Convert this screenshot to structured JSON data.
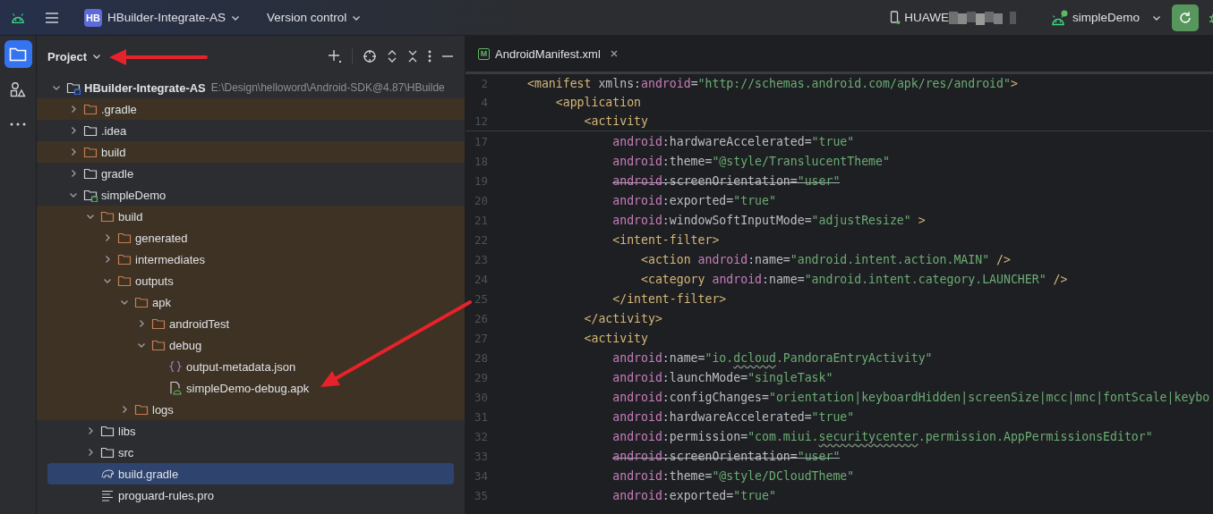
{
  "toolbar": {
    "project": {
      "badge": "HB",
      "name": "HBuilder-Integrate-AS"
    },
    "vcs": "Version control",
    "device": {
      "name": "HUAWE",
      "redacted": true
    },
    "run_config": "simpleDemo"
  },
  "tool_strip": [
    {
      "kind": "project",
      "selected": true
    },
    {
      "kind": "structure",
      "selected": false
    },
    {
      "kind": "more",
      "selected": false
    }
  ],
  "project_panel": {
    "title": "Project",
    "tree": [
      {
        "label": "HBuilder-Integrate-AS",
        "path": "E:\\Design\\helloword\\Android-SDK@4.87\\HBuilde",
        "kind": "module",
        "color": "#3574f0",
        "expanded": true,
        "selected": false,
        "excluded": false,
        "children": [
          {
            "label": ".gradle",
            "kind": "folder",
            "expanded": false,
            "selected": false,
            "excluded": true
          },
          {
            "label": ".idea",
            "kind": "folder",
            "expanded": false,
            "selected": false,
            "excluded": false
          },
          {
            "label": "build",
            "kind": "folder",
            "expanded": false,
            "selected": false,
            "excluded": true
          },
          {
            "label": "gradle",
            "kind": "folder",
            "expanded": false,
            "selected": false,
            "excluded": false
          },
          {
            "label": "simpleDemo",
            "kind": "module",
            "color": "#5fb865",
            "expanded": true,
            "selected": false,
            "excluded": false,
            "children": [
              {
                "label": "build",
                "kind": "folder",
                "expanded": true,
                "selected": false,
                "excluded": true,
                "children": [
                  {
                    "label": "generated",
                    "kind": "folder",
                    "expanded": false,
                    "selected": false,
                    "excluded": true
                  },
                  {
                    "label": "intermediates",
                    "kind": "folder",
                    "expanded": false,
                    "selected": false,
                    "excluded": true
                  },
                  {
                    "label": "outputs",
                    "kind": "folder",
                    "expanded": true,
                    "selected": false,
                    "excluded": true,
                    "children": [
                      {
                        "label": "apk",
                        "kind": "folder",
                        "expanded": true,
                        "selected": false,
                        "excluded": true,
                        "children": [
                          {
                            "label": "androidTest",
                            "kind": "folder",
                            "expanded": false,
                            "selected": false,
                            "excluded": true
                          },
                          {
                            "label": "debug",
                            "kind": "folder",
                            "expanded": true,
                            "selected": false,
                            "excluded": true,
                            "children": [
                              {
                                "label": "output-metadata.json",
                                "kind": "json",
                                "selected": false,
                                "excluded": true
                              },
                              {
                                "label": "simpleDemo-debug.apk",
                                "kind": "apk",
                                "selected": false,
                                "excluded": true
                              }
                            ]
                          }
                        ]
                      },
                      {
                        "label": "logs",
                        "kind": "folder",
                        "expanded": false,
                        "selected": false,
                        "excluded": true
                      }
                    ]
                  }
                ]
              },
              {
                "label": "libs",
                "kind": "folder",
                "expanded": false,
                "selected": false,
                "excluded": false
              },
              {
                "label": "src",
                "kind": "folder",
                "expanded": false,
                "selected": false,
                "excluded": false
              },
              {
                "label": "build.gradle",
                "kind": "gradle",
                "selected": true,
                "excluded": false
              },
              {
                "label": "proguard-rules.pro",
                "kind": "text",
                "selected": false,
                "excluded": false
              }
            ]
          }
        ]
      }
    ]
  },
  "editor": {
    "tabs": [
      {
        "icon_letter": "M",
        "label": "AndroidManifest.xml",
        "selected": true
      }
    ],
    "sticky_lines": [
      {
        "number": "2",
        "deprecated": false,
        "tokens": [
          {
            "kind": "tag",
            "text": "<manifest"
          },
          {
            "kind": "attr",
            "text": " xmlns:"
          },
          {
            "kind": "ns",
            "text": "android"
          },
          {
            "kind": "attr",
            "text": "="
          },
          {
            "kind": "string",
            "text": "\"http://schemas.android.com/apk/res/android\""
          },
          {
            "kind": "tag",
            "text": ">"
          }
        ]
      },
      {
        "number": "4",
        "deprecated": false,
        "tokens": [
          {
            "kind": "tag",
            "text": "    <application"
          }
        ]
      },
      {
        "number": "12",
        "deprecated": false,
        "tokens": [
          {
            "kind": "tag",
            "text": "        <activity"
          }
        ]
      }
    ],
    "lines": [
      {
        "number": "17",
        "deprecated": false,
        "tokens": [
          {
            "kind": "ns",
            "text": "            android"
          },
          {
            "kind": "attr",
            "text": ":hardwareAccelerated="
          },
          {
            "kind": "string",
            "text": "\"true\""
          }
        ]
      },
      {
        "number": "18",
        "deprecated": false,
        "tokens": [
          {
            "kind": "ns",
            "text": "            android"
          },
          {
            "kind": "attr",
            "text": ":theme="
          },
          {
            "kind": "string",
            "text": "\"@style/TranslucentTheme\""
          }
        ]
      },
      {
        "number": "19",
        "deprecated": true,
        "tokens": [
          {
            "kind": "ns",
            "text": "            android"
          },
          {
            "kind": "attr",
            "text": ":screenOrientation="
          },
          {
            "kind": "string",
            "text": "\"user\""
          }
        ]
      },
      {
        "number": "20",
        "deprecated": false,
        "tokens": [
          {
            "kind": "ns",
            "text": "            android"
          },
          {
            "kind": "attr",
            "text": ":exported="
          },
          {
            "kind": "string",
            "text": "\"true\""
          }
        ]
      },
      {
        "number": "21",
        "deprecated": false,
        "tokens": [
          {
            "kind": "ns",
            "text": "            android"
          },
          {
            "kind": "attr",
            "text": ":windowSoftInputMode="
          },
          {
            "kind": "string",
            "text": "\"adjustResize\""
          },
          {
            "kind": "tag",
            "text": " >"
          }
        ]
      },
      {
        "number": "22",
        "deprecated": false,
        "tokens": [
          {
            "kind": "tag",
            "text": "            <intent-filter>"
          }
        ]
      },
      {
        "number": "23",
        "deprecated": false,
        "tokens": [
          {
            "kind": "tag",
            "text": "                <action "
          },
          {
            "kind": "ns",
            "text": "android"
          },
          {
            "kind": "attr",
            "text": ":name="
          },
          {
            "kind": "string",
            "text": "\"android.intent.action.MAIN\""
          },
          {
            "kind": "tag",
            "text": " />"
          }
        ]
      },
      {
        "number": "24",
        "deprecated": false,
        "tokens": [
          {
            "kind": "tag",
            "text": "                <category "
          },
          {
            "kind": "ns",
            "text": "android"
          },
          {
            "kind": "attr",
            "text": ":name="
          },
          {
            "kind": "string",
            "text": "\"android.intent.category.LAUNCHER\""
          },
          {
            "kind": "tag",
            "text": " />"
          }
        ]
      },
      {
        "number": "25",
        "deprecated": false,
        "tokens": [
          {
            "kind": "tag",
            "text": "            </intent-filter>"
          }
        ]
      },
      {
        "number": "26",
        "deprecated": false,
        "tokens": [
          {
            "kind": "tag",
            "text": "        </activity>"
          }
        ]
      },
      {
        "number": "27",
        "deprecated": false,
        "tokens": [
          {
            "kind": "tag",
            "text": "        <activity"
          }
        ]
      },
      {
        "number": "28",
        "deprecated": false,
        "tokens": [
          {
            "kind": "ns",
            "text": "            android"
          },
          {
            "kind": "attr",
            "text": ":name="
          },
          {
            "kind": "string",
            "text": "\"io."
          },
          {
            "kind": "typo",
            "text": "dcloud"
          },
          {
            "kind": "string",
            "text": ".PandoraEntryActivity\""
          }
        ]
      },
      {
        "number": "29",
        "deprecated": false,
        "tokens": [
          {
            "kind": "ns",
            "text": "            android"
          },
          {
            "kind": "attr",
            "text": ":launchMode="
          },
          {
            "kind": "string",
            "text": "\"singleTask\""
          }
        ]
      },
      {
        "number": "30",
        "deprecated": false,
        "tokens": [
          {
            "kind": "ns",
            "text": "            android"
          },
          {
            "kind": "attr",
            "text": ":configChanges="
          },
          {
            "kind": "string",
            "text": "\"orientation|keyboardHidden|screenSize|mcc|mnc|fontScale|keybo"
          }
        ]
      },
      {
        "number": "31",
        "deprecated": false,
        "tokens": [
          {
            "kind": "ns",
            "text": "            android"
          },
          {
            "kind": "attr",
            "text": ":hardwareAccelerated="
          },
          {
            "kind": "string",
            "text": "\"true\""
          }
        ]
      },
      {
        "number": "32",
        "deprecated": false,
        "tokens": [
          {
            "kind": "ns",
            "text": "            android"
          },
          {
            "kind": "attr",
            "text": ":permission="
          },
          {
            "kind": "string",
            "text": "\"com.miui."
          },
          {
            "kind": "typo",
            "text": "securitycenter"
          },
          {
            "kind": "string",
            "text": ".permission.AppPermissionsEditor\""
          }
        ]
      },
      {
        "number": "33",
        "deprecated": true,
        "tokens": [
          {
            "kind": "ns",
            "text": "            android"
          },
          {
            "kind": "attr",
            "text": ":screenOrientation="
          },
          {
            "kind": "string",
            "text": "\"user\""
          }
        ]
      },
      {
        "number": "34",
        "deprecated": false,
        "tokens": [
          {
            "kind": "ns",
            "text": "            android"
          },
          {
            "kind": "attr",
            "text": ":theme="
          },
          {
            "kind": "string",
            "text": "\"@style/DCloudTheme\""
          }
        ]
      },
      {
        "number": "35",
        "deprecated": false,
        "tokens": [
          {
            "kind": "ns",
            "text": "            android"
          },
          {
            "kind": "attr",
            "text": ":exported="
          },
          {
            "kind": "string",
            "text": "\"true\""
          }
        ]
      }
    ]
  },
  "annotations": [
    {
      "kind": "arrow"
    },
    {
      "kind": "arrow"
    }
  ]
}
